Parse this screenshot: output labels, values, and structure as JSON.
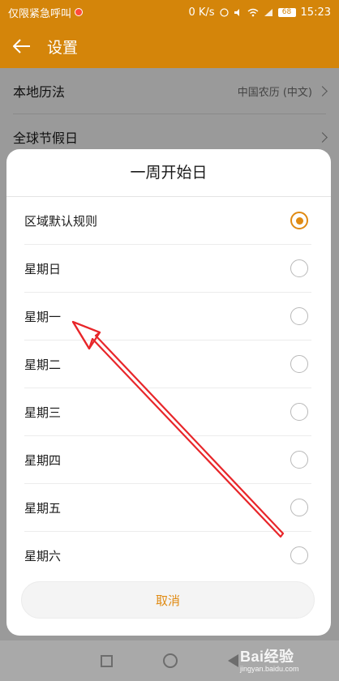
{
  "status_bar": {
    "left_text": "仅限紧急呼叫",
    "speed": "0 K/s",
    "battery": "68",
    "time": "15:23"
  },
  "header": {
    "title": "设置",
    "back_icon": "arrow-left-icon"
  },
  "settings": {
    "items": [
      {
        "label": "本地历法",
        "value": "中国农历 (中文)"
      },
      {
        "label": "全球节假日",
        "value": ""
      }
    ]
  },
  "dialog": {
    "title": "一周开始日",
    "options": [
      {
        "label": "区域默认规则",
        "selected": true
      },
      {
        "label": "星期日",
        "selected": false
      },
      {
        "label": "星期一",
        "selected": false
      },
      {
        "label": "星期二",
        "selected": false
      },
      {
        "label": "星期三",
        "selected": false
      },
      {
        "label": "星期四",
        "selected": false
      },
      {
        "label": "星期五",
        "selected": false
      },
      {
        "label": "星期六",
        "selected": false
      }
    ],
    "cancel_label": "取消"
  },
  "watermark": {
    "brand": "Bai经验",
    "url": "jingyan.baidu.com"
  },
  "colors": {
    "accent": "#e08a12",
    "header_bg": "#d4850a",
    "annotation_arrow": "#e8262a"
  }
}
